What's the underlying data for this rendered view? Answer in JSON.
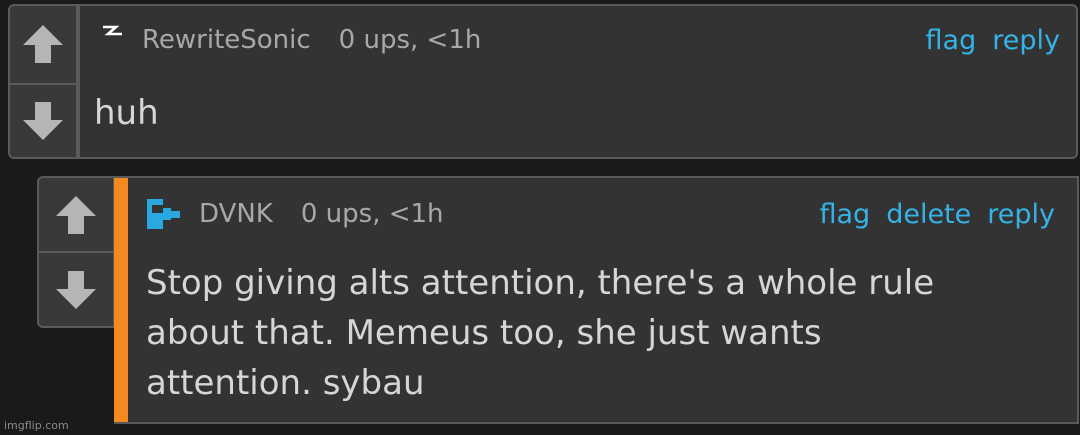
{
  "comment1": {
    "username": "RewriteSonic",
    "meta": "0 ups, <1h",
    "actions": [
      "flag",
      "reply"
    ],
    "text": "huh",
    "avatar_icon": "lightning-bolt-icon"
  },
  "comment2": {
    "username": "DVNK",
    "meta": "0 ups, <1h",
    "actions": [
      "flag",
      "delete",
      "reply"
    ],
    "text_lines": [
      "Stop giving alts attention, there's a whole rule",
      "about that. Memeus too, she just wants",
      "attention. sybau"
    ],
    "avatar_icon": "blue-block-logo-icon",
    "accent_color": "#f5891f"
  },
  "colors": {
    "background": "#1a1a1a",
    "panel": "#333333",
    "link": "#35b3e6",
    "muted_text": "#a8a8a8",
    "body_text": "#d6d6d6"
  },
  "watermark": "imgflip.com"
}
